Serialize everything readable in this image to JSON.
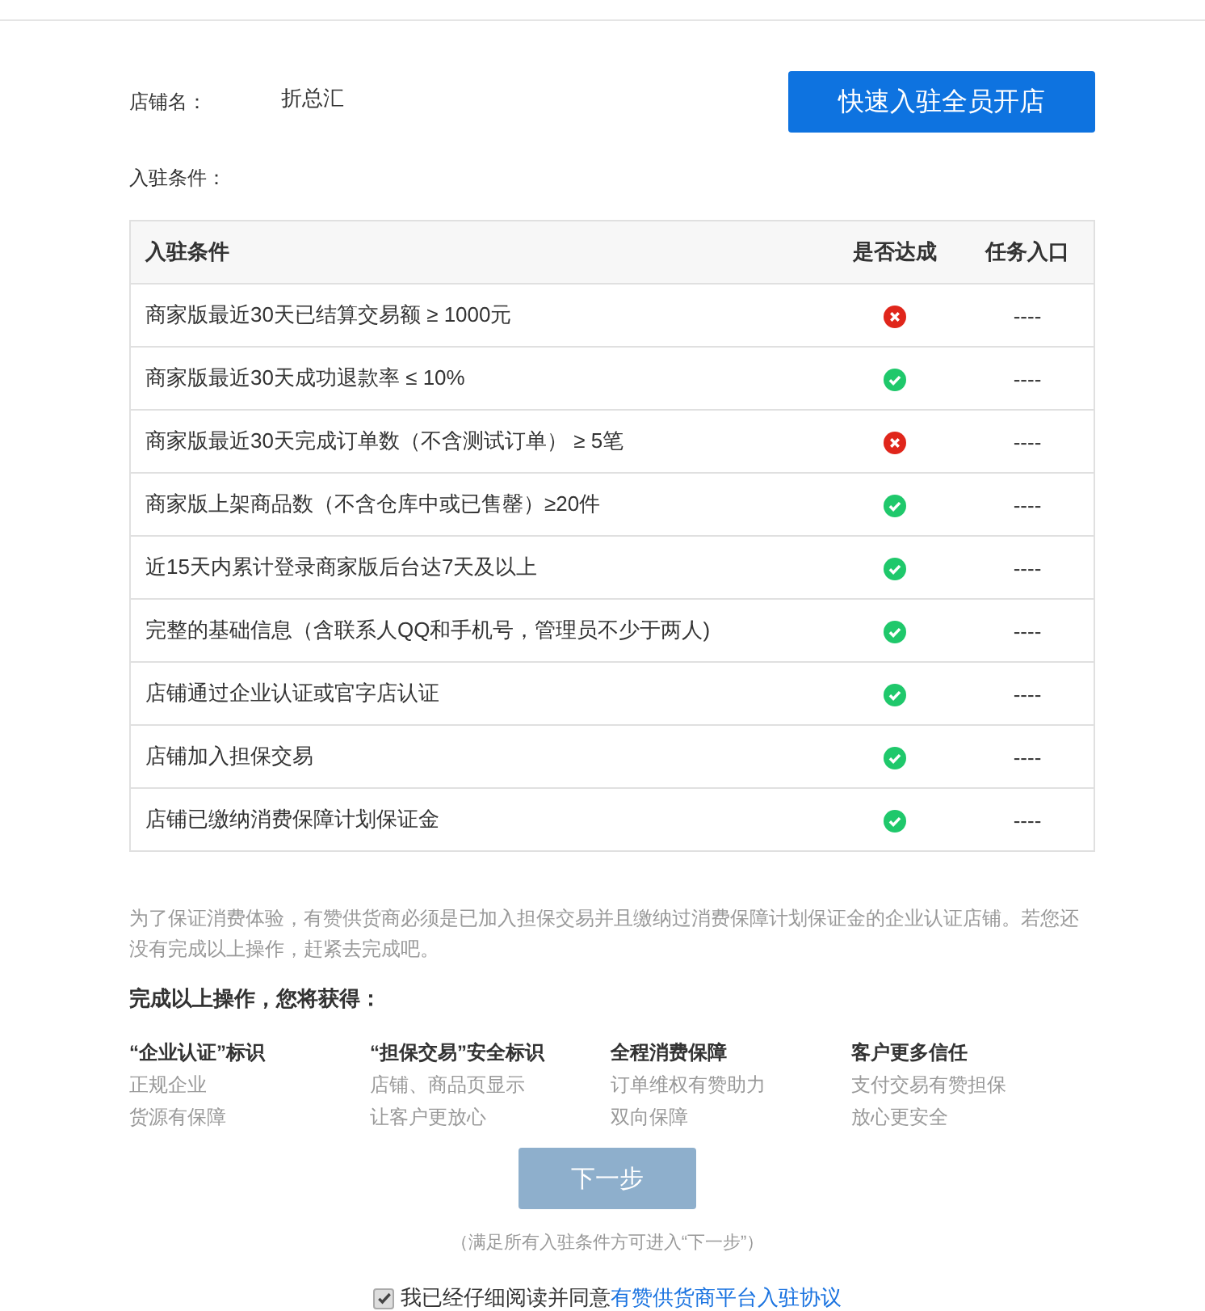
{
  "shop": {
    "label": "店铺名：",
    "name": "折总汇"
  },
  "quick_button": "快速入驻全员开店",
  "conditions_label": "入驻条件：",
  "table": {
    "columns": [
      "入驻条件",
      "是否达成",
      "任务入口"
    ],
    "rows": [
      {
        "condition": "商家版最近30天已结算交易额 ≥ 1000元",
        "achieved": false,
        "entry": "----"
      },
      {
        "condition": "商家版最近30天成功退款率 ≤ 10%",
        "achieved": true,
        "entry": "----"
      },
      {
        "condition": "商家版最近30天完成订单数（不含测试订单） ≥ 5笔",
        "achieved": false,
        "entry": "----"
      },
      {
        "condition": "商家版上架商品数（不含仓库中或已售罄）≥20件",
        "achieved": true,
        "entry": "----"
      },
      {
        "condition": "近15天内累计登录商家版后台达7天及以上",
        "achieved": true,
        "entry": "----"
      },
      {
        "condition": "完整的基础信息（含联系人QQ和手机号，管理员不少于两人)",
        "achieved": true,
        "entry": "----"
      },
      {
        "condition": "店铺通过企业认证或官字店认证",
        "achieved": true,
        "entry": "----"
      },
      {
        "condition": "店铺加入担保交易",
        "achieved": true,
        "entry": "----"
      },
      {
        "condition": "店铺已缴纳消费保障计划保证金",
        "achieved": true,
        "entry": "----"
      }
    ]
  },
  "notice": "为了保证消费体验，有赞供货商必须是已加入担保交易并且缴纳过消费保障计划保证金的企业认证店铺。若您还没有完成以上操作，赶紧去完成吧。",
  "benefits_title": "完成以上操作，您将获得：",
  "benefits": [
    {
      "title": "“企业认证”标识",
      "lines": [
        "正规企业",
        "货源有保障"
      ]
    },
    {
      "title": "“担保交易”安全标识",
      "lines": [
        "店铺、商品页显示",
        "让客户更放心"
      ]
    },
    {
      "title": "全程消费保障",
      "lines": [
        "订单维权有赞助力",
        "双向保障"
      ]
    },
    {
      "title": "客户更多信任",
      "lines": [
        "支付交易有赞担保",
        "放心更安全"
      ]
    }
  ],
  "next_button": {
    "label": "下一步",
    "disabled": true
  },
  "next_hint": "（满足所有入驻条件方可进入“下一步”）",
  "agreement": {
    "checked": true,
    "text": "我已经仔细阅读并同意",
    "link": "有赞供货商平台入驻协议"
  }
}
